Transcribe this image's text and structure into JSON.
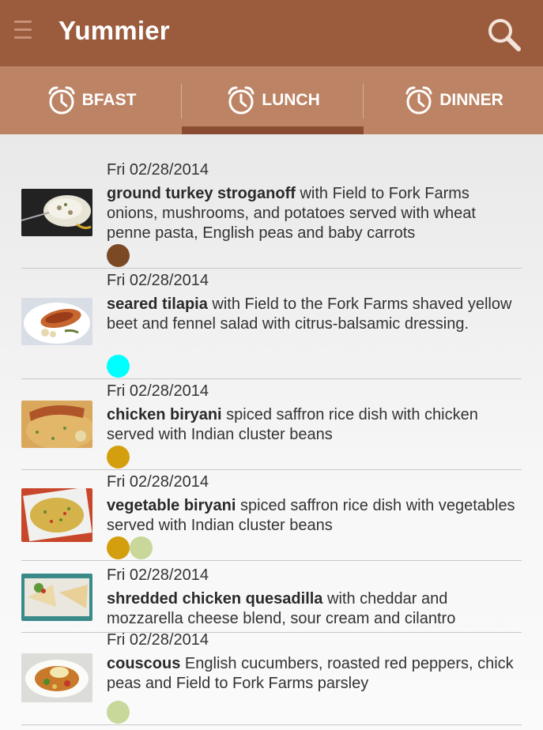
{
  "app": {
    "title": "Yummier"
  },
  "tabs": [
    {
      "label": "BFAST",
      "selected": false
    },
    {
      "label": "LUNCH",
      "selected": true
    },
    {
      "label": "DINNER",
      "selected": false
    }
  ],
  "colors": {
    "actionbar": "#9b5c3e",
    "tabbar": "#bc8465",
    "indicator": "#8a4d33"
  },
  "meals": [
    {
      "date": "Fri 02/28/2014",
      "name": "ground turkey stroganoff",
      "details": " with Field to Fork Farms onions, mushrooms, and potatoes served with wheat penne pasta, English peas and baby carrots",
      "tags": [
        "#7b4a25"
      ]
    },
    {
      "date": "Fri 02/28/2014",
      "name": "seared tilapia",
      "details": " with Field to the Fork Farms shaved yellow beet and fennel salad with citrus-balsamic dressing.",
      "tags": [
        "#00ffff"
      ]
    },
    {
      "date": "Fri 02/28/2014",
      "name": "chicken biryani",
      "details": " spiced saffron rice dish with chicken served with Indian cluster beans",
      "tags": [
        "#d49f0e"
      ]
    },
    {
      "date": "Fri 02/28/2014",
      "name": "vegetable biryani",
      "details": " spiced saffron rice dish with vegetables served with Indian cluster beans",
      "tags": [
        "#d49f0e",
        "#c8d79a"
      ]
    },
    {
      "date": "Fri 02/28/2014",
      "name": "shredded chicken quesadilla",
      "details": " with cheddar and mozzarella cheese blend, sour cream and cilantro",
      "tags": []
    },
    {
      "date": "Fri 02/28/2014",
      "name": "couscous",
      "details": " English cucumbers, roasted red peppers, chick peas and Field to Fork Farms parsley",
      "tags": [
        "#c8d79a"
      ]
    }
  ]
}
